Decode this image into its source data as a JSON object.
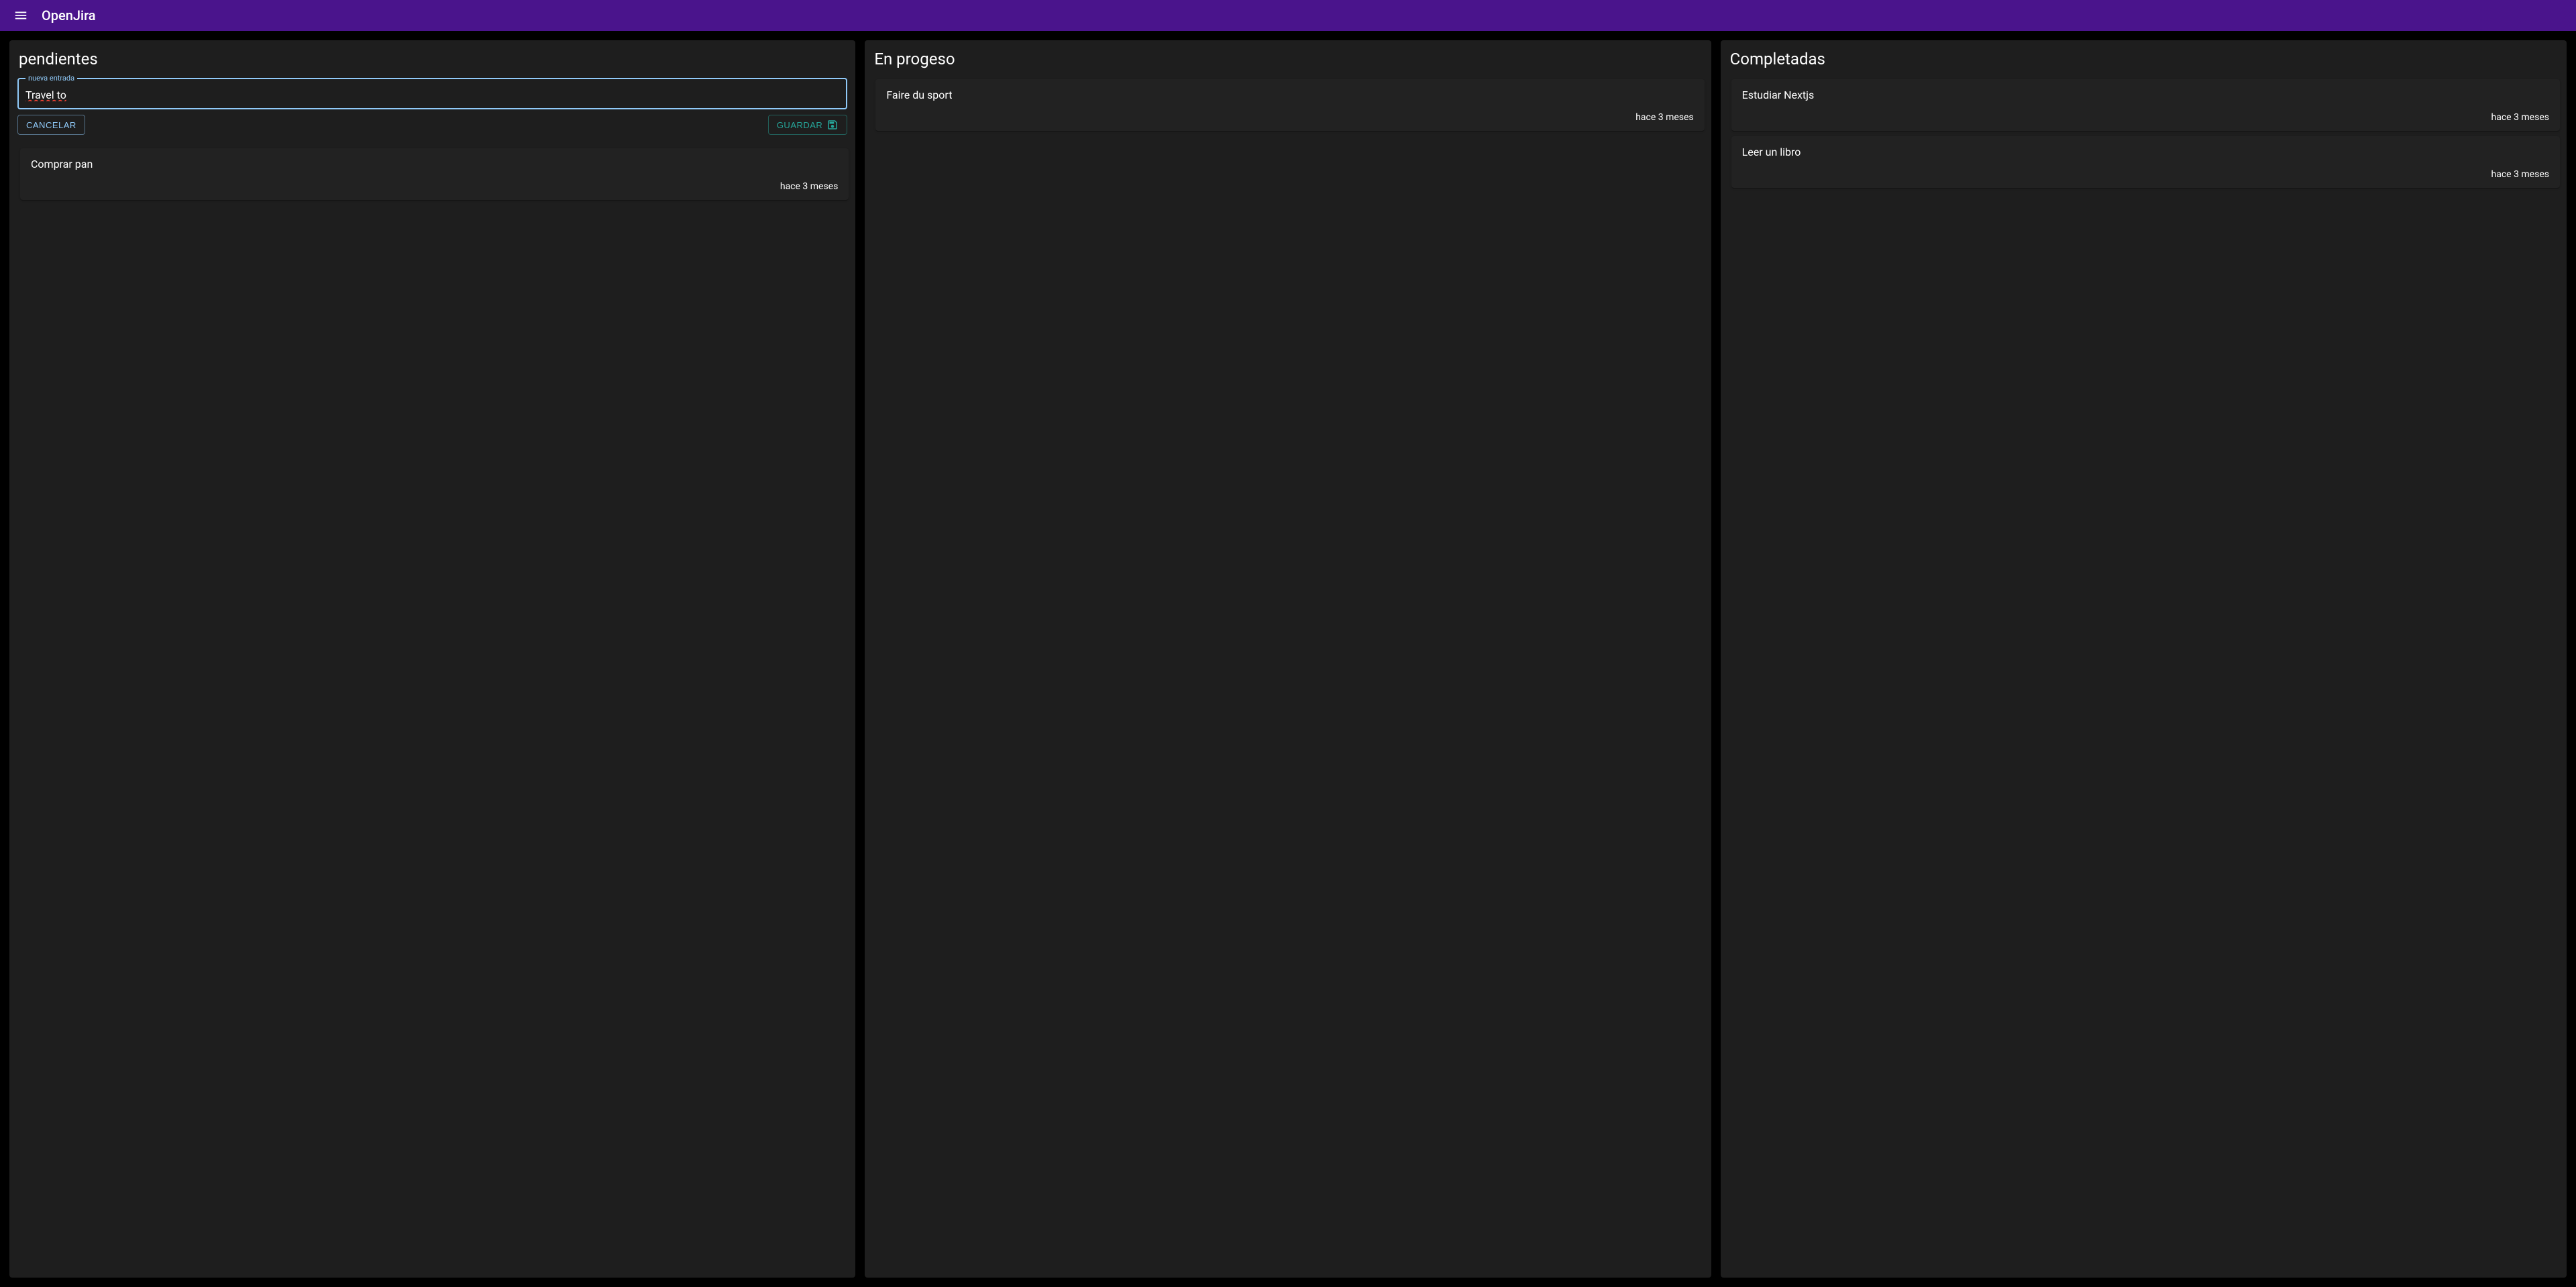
{
  "header": {
    "title": "OpenJira"
  },
  "columns": [
    {
      "title": "pendientes",
      "has_entry_form": true,
      "entry": {
        "label": "nueva entrada",
        "value": "Travel to",
        "cancel_label": "Cancelar",
        "save_label": "Guardar"
      },
      "cards": [
        {
          "title": "Comprar pan",
          "time": "hace 3 meses"
        }
      ]
    },
    {
      "title": "En progeso",
      "has_entry_form": false,
      "cards": [
        {
          "title": "Faire du sport",
          "time": "hace 3 meses"
        }
      ]
    },
    {
      "title": "Completadas",
      "has_entry_form": false,
      "cards": [
        {
          "title": "Estudiar Nextjs",
          "time": "hace 3 meses"
        },
        {
          "title": "Leer un libro",
          "time": "hace 3 meses"
        }
      ]
    }
  ]
}
